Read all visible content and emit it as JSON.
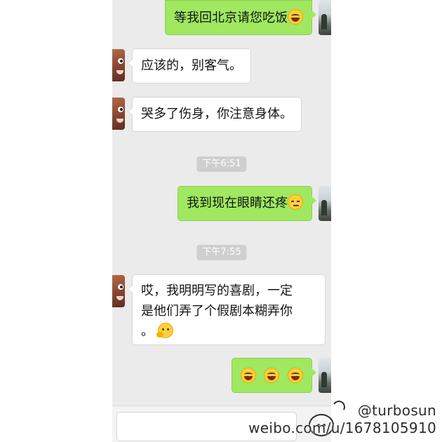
{
  "messages": [
    {
      "side": "out",
      "text": "等我回北京请您吃饭",
      "emoji": "laugh"
    },
    {
      "side": "in",
      "text": "应该的，别客气。"
    },
    {
      "side": "in",
      "text": "哭多了伤身，你注意身体。"
    },
    {
      "type": "time",
      "text": "下午6:51"
    },
    {
      "side": "out",
      "text": "我到现在眼睛还疼",
      "emoji": "sad"
    },
    {
      "type": "time",
      "text": "下午7:55"
    },
    {
      "side": "in",
      "lines": [
        "哎，我明明写的喜剧，一定",
        "是他们弄了个假剧本糊弄你",
        "。"
      ],
      "emoji": "think"
    },
    {
      "side": "out",
      "emojis": [
        "laugh",
        "laugh",
        "laugh"
      ]
    }
  ],
  "watermark": {
    "handle": "@turbosun",
    "url": "weibo.com/u/1678105910"
  },
  "colors": {
    "chat_bg": "#ebebeb",
    "out_bubble": "#9fe860",
    "in_bubble": "#ffffff",
    "time_badge": "#cfcfcf"
  }
}
